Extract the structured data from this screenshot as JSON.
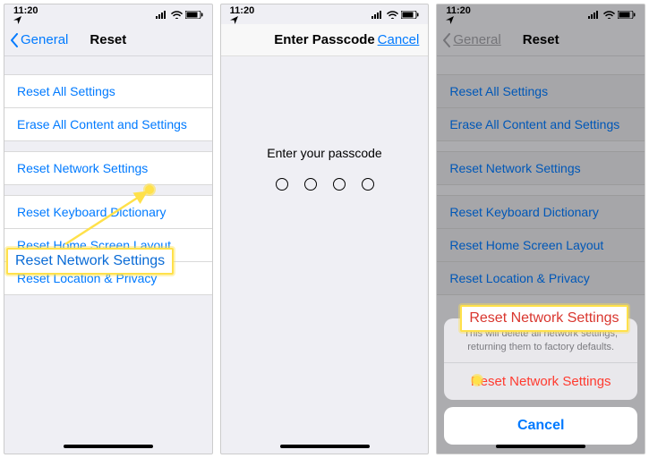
{
  "status": {
    "time": "11:20"
  },
  "screen1": {
    "back": "General",
    "title": "Reset",
    "items": [
      "Reset All Settings",
      "Erase All Content and Settings",
      "Reset Network Settings",
      "Reset Keyboard Dictionary",
      "Reset Home Screen Layout",
      "Reset Location & Privacy"
    ],
    "callout": "Reset Network Settings"
  },
  "screen2": {
    "title": "Enter Passcode",
    "cancel": "Cancel",
    "prompt": "Enter your passcode"
  },
  "screen3": {
    "back": "General",
    "title": "Reset",
    "items": [
      "Reset All Settings",
      "Erase All Content and Settings",
      "Reset Network Settings",
      "Reset Keyboard Dictionary",
      "Reset Home Screen Layout",
      "Reset Location & Privacy"
    ],
    "callout": "Reset Network Settings",
    "sheet": {
      "message": "This will delete all network settings, returning them to factory defaults.",
      "action": "Reset Network Settings",
      "cancel": "Cancel"
    }
  }
}
